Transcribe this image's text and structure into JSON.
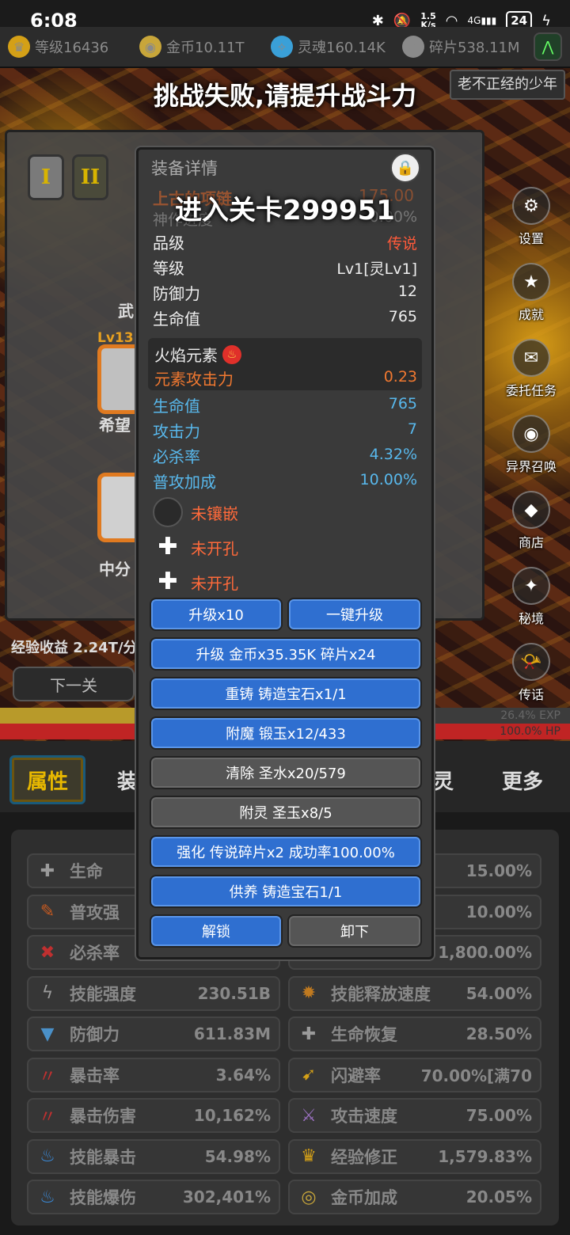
{
  "status": {
    "time": "6:08",
    "netspeed_value": "1.5",
    "netspeed_unit": "K/s",
    "signal": "4G",
    "battery": "24"
  },
  "resources": [
    {
      "icon": "crown-icon",
      "label": "等级16436",
      "color": "#d4a017"
    },
    {
      "icon": "coin-icon",
      "label": "金币10.11T",
      "color": "#c8a63a"
    },
    {
      "icon": "soul-icon",
      "label": "灵魂160.14K",
      "color": "#3aa0d8"
    },
    {
      "icon": "shard-icon",
      "label": "碎片538.11M",
      "color": "#8a8a8a"
    }
  ],
  "battle": {
    "user_name": "老不正经的少年",
    "toast_top": "挑战失败,请提升战斗力",
    "toast_mid": "进入关卡299951",
    "side_menu": [
      {
        "icon": "gear-icon",
        "label": "设置",
        "glyph": "⚙"
      },
      {
        "icon": "star-icon",
        "label": "成就",
        "glyph": "★"
      },
      {
        "icon": "scroll-icon",
        "label": "委托任务",
        "glyph": "✉"
      },
      {
        "icon": "portal-icon",
        "label": "异界召唤",
        "glyph": "◉"
      },
      {
        "icon": "shop-icon",
        "label": "商店",
        "glyph": "◆"
      },
      {
        "icon": "realm-icon",
        "label": "秘境",
        "glyph": "✦"
      },
      {
        "icon": "horn-icon",
        "label": "传话",
        "glyph": "📯"
      }
    ],
    "under_panel": {
      "tab_one": "I",
      "tab_two": "II",
      "weapon_label": "武",
      "level_badge": "Lv13",
      "slot_one_name": "希望",
      "slot_two_name": "中分"
    },
    "exp_income": "经验收益 2.24T/分",
    "next_level_button": "下一关",
    "exp_bar": {
      "text": "26.4% EXP",
      "percent": 26.4,
      "color": "#b89a2a"
    },
    "hp_bar": {
      "text": "100.0%  HP",
      "percent": 100.0,
      "color": "#c02424"
    }
  },
  "tabs": [
    {
      "label": "属性",
      "active": true
    },
    {
      "label": "装",
      "active": false
    },
    {
      "label": "灵",
      "active": false
    },
    {
      "label": "更多",
      "active": false
    }
  ],
  "stats": [
    {
      "icon": "health-icon",
      "glyph": "✚",
      "label": "生命",
      "value": "",
      "color": "#9a9a9a"
    },
    {
      "icon": "hidden-icon",
      "glyph": "",
      "label": "",
      "value": "15.00%",
      "color": "#9a9a9a"
    },
    {
      "icon": "attack-icon",
      "glyph": "✎",
      "label": "普攻强",
      "value": "",
      "color": "#c85a20"
    },
    {
      "icon": "hidden-icon",
      "glyph": "",
      "label": "",
      "value": "10.00%",
      "color": "#9a9a9a"
    },
    {
      "icon": "crit-kill-icon",
      "glyph": "✖",
      "label": "必杀率",
      "value": "",
      "color": "#c03030"
    },
    {
      "icon": "hidden-icon",
      "glyph": "",
      "label": "",
      "value": "1,800.00%",
      "color": "#9a9a9a"
    },
    {
      "icon": "skill-power-icon",
      "glyph": "ϟ",
      "label": "技能强度",
      "value": "230.51B",
      "color": "#9a9a9a"
    },
    {
      "icon": "skill-speed-icon",
      "glyph": "✹",
      "label": "技能释放速度",
      "value": "54.00%",
      "color": "#c07a20"
    },
    {
      "icon": "shield-icon",
      "glyph": "▼",
      "label": "防御力",
      "value": "611.83M",
      "color": "#4a90c8"
    },
    {
      "icon": "regen-icon",
      "glyph": "✚",
      "label": "生命恢复",
      "value": "28.50%",
      "color": "#9a9a9a"
    },
    {
      "icon": "crit-rate-icon",
      "glyph": "〃",
      "label": "暴击率",
      "value": "3.64%",
      "color": "#c03030"
    },
    {
      "icon": "dodge-icon",
      "glyph": "➹",
      "label": "闪避率",
      "value": "70.00%[满70",
      "color": "#d4a017"
    },
    {
      "icon": "crit-damage-icon",
      "glyph": "〃",
      "label": "暴击伤害",
      "value": "10,162%",
      "color": "#c03030"
    },
    {
      "icon": "attack-speed-icon",
      "glyph": "⚔",
      "label": "攻击速度",
      "value": "75.00%",
      "color": "#9a70c0"
    },
    {
      "icon": "skill-crit-icon",
      "glyph": "♨",
      "label": "技能暴击",
      "value": "54.98%",
      "color": "#3a8ad8"
    },
    {
      "icon": "exp-crown-icon",
      "glyph": "♛",
      "label": "经验修正",
      "value": "1,579.83%",
      "color": "#d4a017"
    },
    {
      "icon": "skill-burst-icon",
      "glyph": "♨",
      "label": "技能爆伤",
      "value": "302,401%",
      "color": "#3a8ad8"
    },
    {
      "icon": "gold-bonus-icon",
      "glyph": "◎",
      "label": "金币加成",
      "value": "20.05%",
      "color": "#c8a63a"
    }
  ],
  "modal": {
    "title": "装备详情",
    "item_name": "上古的项链",
    "item_power": "175.00",
    "progress_label": "神作进度",
    "progress_value": "0.00%",
    "basic": [
      {
        "label": "品级",
        "value": "传说",
        "legend": true
      },
      {
        "label": "等级",
        "value": "Lv1[灵Lv1]",
        "legend": false
      },
      {
        "label": "防御力",
        "value": "12",
        "legend": false
      },
      {
        "label": "生命值",
        "value": "765",
        "legend": false
      }
    ],
    "element": {
      "title": "火焰元素",
      "label": "元素攻击力",
      "value": "0.23"
    },
    "attributes": [
      {
        "label": "生命值",
        "value": "765"
      },
      {
        "label": "攻击力",
        "value": "7"
      },
      {
        "label": "必杀率",
        "value": "4.32%"
      },
      {
        "label": "普攻加成",
        "value": "10.00%"
      }
    ],
    "sockets": [
      {
        "type": "empty",
        "text": "未镶嵌"
      },
      {
        "type": "plus",
        "text": "未开孔"
      },
      {
        "type": "plus",
        "text": "未开孔"
      }
    ],
    "buttons": {
      "upgrade_x10": "升级x10",
      "one_key_upgrade": "一键升级",
      "upgrade_cost": "升级 金币x35.35K 碎片x24",
      "recast": "重铸 铸造宝石x1/1",
      "enchant": "附魔 锻玉x12/433",
      "clear": "清除 圣水x20/579",
      "spirit": "附灵 圣玉x8/5",
      "strengthen": "强化 传说碎片x2 成功率100.00%",
      "nurture": "供养 铸造宝石1/1",
      "unlock": "解锁",
      "unequip": "卸下"
    }
  }
}
